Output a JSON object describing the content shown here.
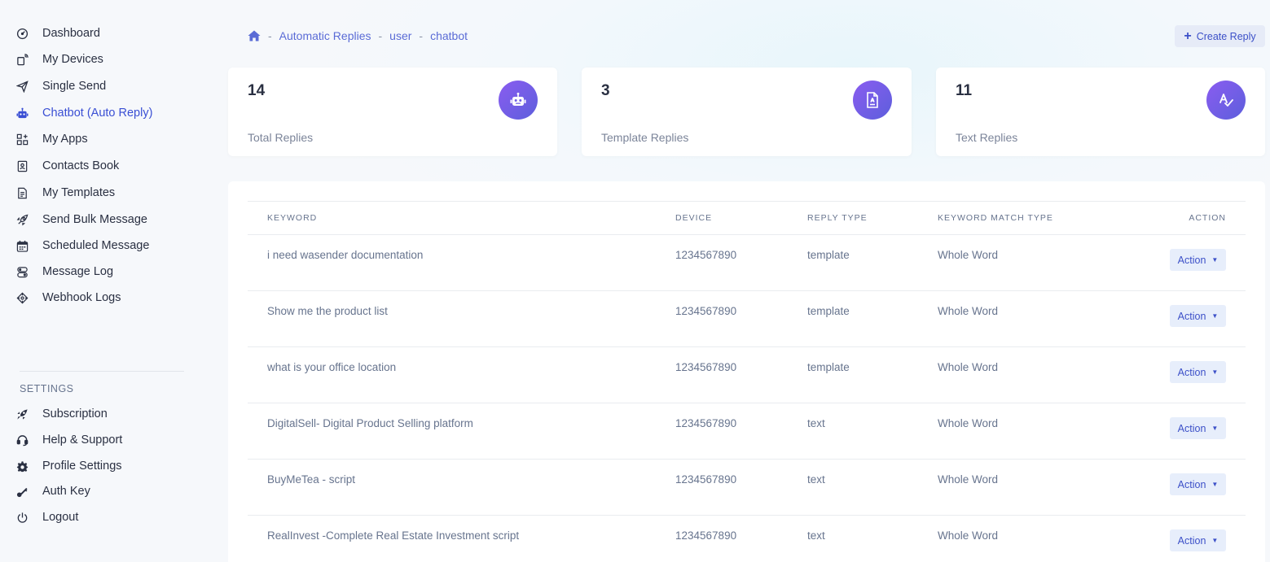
{
  "sidebar": {
    "main_items": [
      {
        "label": "Dashboard",
        "icon": "gauge-icon"
      },
      {
        "label": "My Devices",
        "icon": "device-signal-icon"
      },
      {
        "label": "Single Send",
        "icon": "paper-plane-icon"
      },
      {
        "label": "Chatbot (Auto Reply)",
        "icon": "robot-icon",
        "active": true
      },
      {
        "label": "My Apps",
        "icon": "apps-grid-icon"
      },
      {
        "label": "Contacts Book",
        "icon": "contact-book-icon"
      },
      {
        "label": "My Templates",
        "icon": "template-file-icon"
      },
      {
        "label": "Send Bulk Message",
        "icon": "rocket-icon"
      },
      {
        "label": "Scheduled Message",
        "icon": "calendar-icon"
      },
      {
        "label": "Message Log",
        "icon": "message-log-icon"
      },
      {
        "label": "Webhook Logs",
        "icon": "webhook-icon"
      }
    ],
    "settings_title": "SETTINGS",
    "settings_items": [
      {
        "label": "Subscription",
        "icon": "rocket-launch-icon"
      },
      {
        "label": "Help & Support",
        "icon": "headset-icon"
      },
      {
        "label": "Profile Settings",
        "icon": "gear-icon"
      },
      {
        "label": "Auth Key",
        "icon": "key-icon"
      },
      {
        "label": "Logout",
        "icon": "power-icon"
      }
    ]
  },
  "breadcrumb": {
    "items": [
      "Automatic Replies",
      "user",
      "chatbot"
    ],
    "separator": "-"
  },
  "create_button": {
    "label": "Create Reply"
  },
  "stats": [
    {
      "value": "14",
      "label": "Total Replies",
      "icon": "robot-icon"
    },
    {
      "value": "3",
      "label": "Template Replies",
      "icon": "document-icon"
    },
    {
      "value": "11",
      "label": "Text Replies",
      "icon": "spell-check-icon"
    }
  ],
  "table": {
    "headers": {
      "keyword": "KEYWORD",
      "device": "DEVICE",
      "reply_type": "REPLY TYPE",
      "match_type": "KEYWORD MATCH TYPE",
      "action": "ACTION"
    },
    "rows": [
      {
        "keyword": "i need wasender documentation",
        "device": "1234567890",
        "reply_type": "template",
        "match_type": "Whole Word",
        "action": "Action"
      },
      {
        "keyword": "Show me the product list",
        "device": "1234567890",
        "reply_type": "template",
        "match_type": "Whole Word",
        "action": "Action"
      },
      {
        "keyword": "what is your office location",
        "device": "1234567890",
        "reply_type": "template",
        "match_type": "Whole Word",
        "action": "Action"
      },
      {
        "keyword": "DigitalSell- Digital Product Selling platform",
        "device": "1234567890",
        "reply_type": "text",
        "match_type": "Whole Word",
        "action": "Action"
      },
      {
        "keyword": "BuyMeTea - script",
        "device": "1234567890",
        "reply_type": "text",
        "match_type": "Whole Word",
        "action": "Action"
      },
      {
        "keyword": "RealInvest -Complete Real Estate Investment script",
        "device": "1234567890",
        "reply_type": "text",
        "match_type": "Whole Word",
        "action": "Action"
      }
    ]
  },
  "colors": {
    "accent": "#3a4fd4",
    "badge_gradient_start": "#8a5cf0",
    "badge_gradient_end": "#5d5fdc",
    "action_bg": "#e7eefb"
  }
}
